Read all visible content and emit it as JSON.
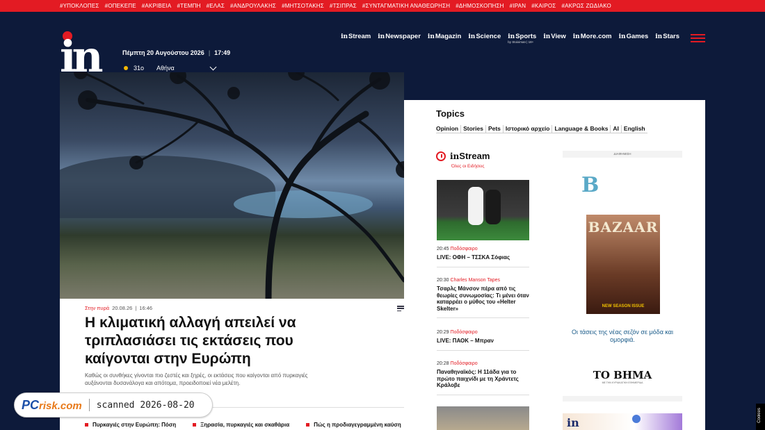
{
  "topbar": {
    "tags": [
      "#ΥΠΟΚΛΟΠΕΣ",
      "#ΟΠΕΚΕΠΕ",
      "#ΑΚΡΙΒΕΙΑ",
      "#ΤΕΜΠΗ",
      "#ΕΛΑΣ",
      "#ΑΝΔΡΟΥΛΑΚΗΣ",
      "#ΜΗΤΣΟΤΑΚΗΣ",
      "#ΤΣΙΠΡΑΣ",
      "#ΣΥΝΤΑΓΜΑΤΙΚΗ ΑΝΑΘΕΩΡΗΣΗ",
      "#ΔΗΜΟΣΚΟΠΗΣΗ",
      "#ΙΡΑΝ",
      "#ΚΑΙΡΟΣ",
      "#ΑΚΡΩΣ ΖΩΔΙΑΚΟ"
    ]
  },
  "header": {
    "logo_text": "in",
    "date": "Πέμπτη 20 Αυγούστου 2026",
    "time": "17:49",
    "temperature": "31o",
    "city": "Αθήνα",
    "nav": [
      {
        "prefix": "in",
        "label": "Stream",
        "sub": ""
      },
      {
        "prefix": "in",
        "label": "Newspaper",
        "sub": ""
      },
      {
        "prefix": "in",
        "label": "Magazin",
        "sub": ""
      },
      {
        "prefix": "in",
        "label": "Science",
        "sub": ""
      },
      {
        "prefix": "in",
        "label": "Sports",
        "sub": "by Stoiximan | 18+"
      },
      {
        "prefix": "in",
        "label": "View",
        "sub": ""
      },
      {
        "prefix": "in",
        "label": "More.com",
        "sub": ""
      },
      {
        "prefix": "in",
        "label": "Games",
        "sub": ""
      },
      {
        "prefix": "in",
        "label": "Stars",
        "sub": ""
      }
    ],
    "accent": "#e31b23",
    "bg": "#0d1a3a"
  },
  "article": {
    "category": "Στην πυρά",
    "date": "20.08.26",
    "time": "16:46",
    "headline": "Η κλιματική αλλαγή απειλεί να τριπλασιάσει τις εκτάσεις που καίγονται στην Ευρώπη",
    "lede": "Καθώς οι συνθήκες γίνονται πιο ζεστές και ξηρές, οι εκτάσεις που καίγονται από πυρκαγιές αυξάνονται δυσανάλογα και απότομα, προειδοποιεί νέα μελέτη.",
    "related": [
      "Πυρκαγιές στην Ευρώπη: Πόση",
      "Ξηρασία, πυρκαγιές και σκαθάρια",
      "Πώς η προδιαγεγραμμένη καύση"
    ]
  },
  "watermark": {
    "brand_pc": "PC",
    "brand_risk": "risk.com",
    "scanned": "scanned 2026-08-20"
  },
  "sidebar": {
    "topics_title": "Topics",
    "topics": [
      "Opinion",
      "Stories",
      "Pets",
      "Ιστορικό αρχείο",
      "Language & Books",
      "AI",
      "English"
    ],
    "instream_prefix": "in",
    "instream_title": "Stream",
    "instream_sub": "Όλες οι Ειδήσεις",
    "news": [
      {
        "time": "20:45",
        "category": "Ποδόσφαιρο",
        "headline": "LIVE: ΟΦΗ – ΤΣΣΚΑ Σόφιας"
      },
      {
        "time": "20:30",
        "category": "Charles Manson Tapes",
        "headline": "Τσαρλς Μάνσον πέρα από τις θεωρίες συνωμοσίας: Τι μένει όταν καταρρέει ο μύθος του «Helter Skelter»"
      },
      {
        "time": "20:29",
        "category": "Ποδόσφαιρο",
        "headline": "LIVE: ΠΑΟΚ – Μπραν"
      },
      {
        "time": "20:28",
        "category": "Ποδόσφαιρο",
        "headline": "Παναθηναϊκός: Η 11άδα για το πρώτο παιχνίδι με τη Χράντετς Κράλοβε"
      }
    ]
  },
  "ad": {
    "label": "ΔΙΑΦΗΜΙΣΗ",
    "letter": "B",
    "masthead": "BAZAAR",
    "new_season": "NEW SEASON ISSUE",
    "slogan": "Οι τάσεις της νέας σεζόν σε μόδα και ομορφιά.",
    "brand": "ΤΟ ΒΗΜΑ",
    "brand_sub": "ΜΕ ΤΗΝ ΚΥΡΙΑΚΑΤΙΚΗ ΕΦΗΜΕΡΙΔΑ",
    "second_ad_logo": "in"
  },
  "cookies_label": "Cookies"
}
